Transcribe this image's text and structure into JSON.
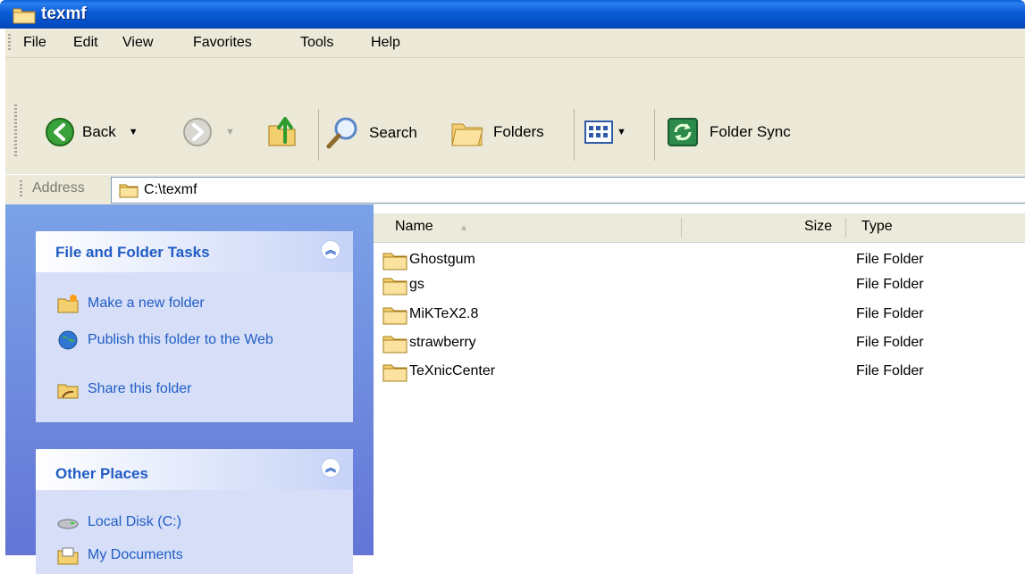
{
  "window": {
    "title": "texmf",
    "icon": "folder-icon"
  },
  "menu": [
    "File",
    "Edit",
    "View",
    "Favorites",
    "Tools",
    "Help"
  ],
  "toolbar": {
    "back_label": "Back",
    "search_label": "Search",
    "folders_label": "Folders",
    "folder_sync_label": "Folder Sync"
  },
  "address": {
    "label": "Address",
    "value": "C:\\texmf"
  },
  "tasks_panel": {
    "title": "File and Folder Tasks",
    "items": [
      {
        "label": "Make a new folder",
        "icon": "new-folder-icon"
      },
      {
        "label": "Publish this folder to the Web",
        "icon": "publish-web-icon"
      },
      {
        "label": "Share this folder",
        "icon": "share-folder-icon"
      }
    ]
  },
  "places_panel": {
    "title": "Other Places",
    "items": [
      {
        "label": "Local Disk (C:)",
        "icon": "local-disk-icon"
      },
      {
        "label": "My Documents",
        "icon": "my-documents-icon"
      }
    ]
  },
  "file_list": {
    "columns": {
      "name": "Name",
      "size": "Size",
      "type": "Type"
    },
    "rows": [
      {
        "name": "Ghostgum",
        "type": "File Folder"
      },
      {
        "name": "gs",
        "type": "File Folder"
      },
      {
        "name": "MiKTeX2.8",
        "type": "File Folder"
      },
      {
        "name": "strawberry",
        "type": "File Folder"
      },
      {
        "name": "TeXnicCenter",
        "type": "File Folder"
      }
    ]
  },
  "colors": {
    "titlebar": "#0a5bd6",
    "chrome": "#ece9d8",
    "taskpane": "#6f8ee0",
    "link": "#215dc6"
  }
}
